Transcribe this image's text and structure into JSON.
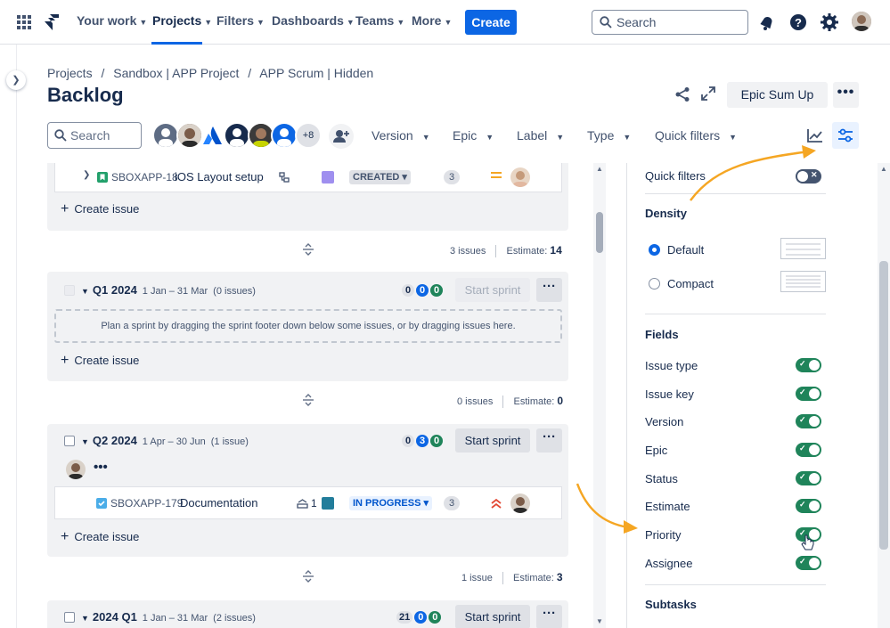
{
  "nav": {
    "items": [
      {
        "label": "Your work",
        "active": false
      },
      {
        "label": "Projects",
        "active": true
      },
      {
        "label": "Filters",
        "active": false
      },
      {
        "label": "Dashboards",
        "active": false
      },
      {
        "label": "Teams",
        "active": false
      },
      {
        "label": "More",
        "active": false
      }
    ],
    "create_label": "Create",
    "search_placeholder": "Search",
    "icons": [
      "apps-grid-icon",
      "jira-logo-icon",
      "notification-icon",
      "help-icon",
      "settings-icon",
      "profile-avatar"
    ]
  },
  "breadcrumbs": [
    "Projects",
    "/",
    "Sandbox | APP Project",
    "/",
    "APP Scrum | Hidden"
  ],
  "page_title": "Backlog",
  "header": {
    "epic_button": "Epic Sum Up",
    "more": "•••"
  },
  "filters": {
    "search_placeholder": "Search",
    "avatar_overflow": "+8",
    "dropdowns": [
      "Version",
      "Epic",
      "Label",
      "Type",
      "Quick filters"
    ]
  },
  "board": {
    "top_issue": {
      "key": "SBOXAPP-18",
      "summary": "iOS Layout setup",
      "status": "CREATED",
      "estimate": "3",
      "epic_color": "#9f8fef"
    },
    "create_issue": "Create issue",
    "sep1": {
      "issues": "3 issues",
      "estimate_label": "Estimate:",
      "estimate": "14"
    },
    "sprint1": {
      "name": "Q1 2024",
      "dates": "1 Jan – 31 Mar",
      "count": "(0 issues)",
      "c1": "0",
      "c2": "0",
      "c3": "0",
      "button": "Start sprint",
      "dropzone": "Plan a sprint by dragging the sprint footer down below some issues, or by dragging issues here."
    },
    "sep2": {
      "issues": "0 issues",
      "estimate_label": "Estimate:",
      "estimate": "0"
    },
    "sprint2": {
      "name": "Q2 2024",
      "dates": "1 Apr – 30 Jun",
      "count": "(1 issue)",
      "c1": "0",
      "c2": "3",
      "c3": "0",
      "button": "Start sprint",
      "more_assignees": "•••",
      "issue": {
        "key": "SBOXAPP-179",
        "summary": "Documentation",
        "child_count": "1",
        "status": "IN PROGRESS",
        "estimate": "3",
        "epic_color": "#227d9b"
      }
    },
    "sep3": {
      "issues": "1 issue",
      "estimate_label": "Estimate:",
      "estimate": "3"
    },
    "sprint3": {
      "name": "2024 Q1",
      "dates": "1 Jan – 31 Mar",
      "count": "(2 issues)",
      "c1": "21",
      "c2": "0",
      "c3": "0",
      "button": "Start sprint"
    }
  },
  "panel": {
    "quick_filters": "Quick filters",
    "quick_filters_on": false,
    "density_title": "Density",
    "density_options": [
      {
        "label": "Default",
        "selected": true
      },
      {
        "label": "Compact",
        "selected": false
      }
    ],
    "fields_title": "Fields",
    "fields": [
      {
        "label": "Issue type",
        "on": true
      },
      {
        "label": "Issue key",
        "on": true
      },
      {
        "label": "Version",
        "on": true
      },
      {
        "label": "Epic",
        "on": true
      },
      {
        "label": "Status",
        "on": true
      },
      {
        "label": "Estimate",
        "on": true
      },
      {
        "label": "Priority",
        "on": true
      },
      {
        "label": "Assignee",
        "on": true
      }
    ],
    "subtasks_title": "Subtasks"
  },
  "colors": {
    "accent": "#0c66e4",
    "toggle_on": "#1f845a",
    "annotation_arrow": "#f5a623"
  }
}
